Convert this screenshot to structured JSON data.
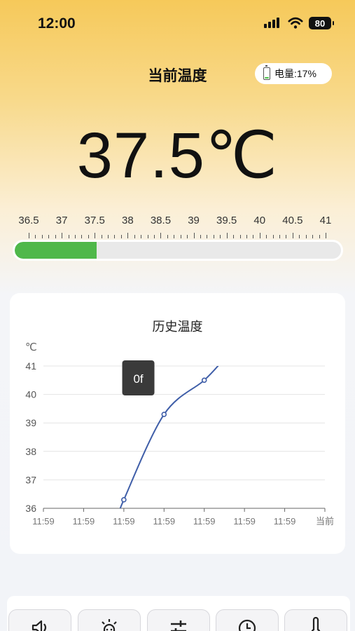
{
  "status_bar": {
    "time": "12:00",
    "battery_level": "80"
  },
  "header": {
    "title": "当前温度",
    "battery_label": "电量:17%",
    "battery_fraction": 0.17
  },
  "current_temperature": {
    "display": "37.5℃",
    "value": 37.5
  },
  "scale": {
    "labels": [
      "36.5",
      "37",
      "37.5",
      "38",
      "38.5",
      "39",
      "39.5",
      "40",
      "40.5",
      "41"
    ],
    "min": 36.5,
    "max": 41,
    "progress_fraction": 0.25,
    "bar_color": "#4fb84a"
  },
  "history": {
    "title": "历史温度",
    "chart_data": {
      "type": "line",
      "ylabel": "℃",
      "y_ticks": [
        "41",
        "40",
        "39",
        "38",
        "37",
        "36"
      ],
      "x_ticks": [
        "11:59",
        "11:59",
        "11:59",
        "11:59",
        "11:59",
        "11:59",
        "11:59",
        "当前"
      ],
      "ylim": [
        36,
        41
      ],
      "grid": true,
      "series": [
        {
          "color": "#3f5ea8",
          "points": [
            [
              2.0,
              36.3
            ],
            [
              3.0,
              39.3
            ],
            [
              4.0,
              40.5
            ]
          ]
        }
      ],
      "tooltip": "0f"
    }
  },
  "toolbar": {
    "items": [
      {
        "name": "speaker-icon"
      },
      {
        "name": "alarm-bulb-icon"
      },
      {
        "name": "sliders-icon"
      },
      {
        "name": "clock-icon"
      },
      {
        "name": "thermometer-icon"
      }
    ]
  }
}
